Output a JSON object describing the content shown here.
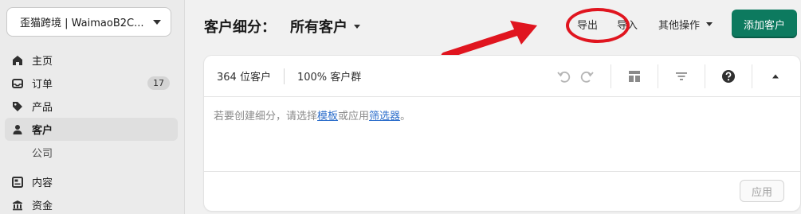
{
  "store": {
    "name": "歪猫跨境 | WaimaoB2C..."
  },
  "nav": {
    "home": "主页",
    "orders": "订单",
    "orders_badge": "17",
    "products": "产品",
    "customers": "客户",
    "company": "公司",
    "content": "内容",
    "finance": "资金"
  },
  "header": {
    "title_prefix": "客户细分：",
    "segment": "所有客户",
    "export": "导出",
    "import": "导入",
    "more_actions": "其他操作",
    "add_customer": "添加客户"
  },
  "card": {
    "customer_count": "364 位客户",
    "segment_share": "100% 客户群",
    "hint_prefix": "若要创建细分，请选择",
    "hint_template_link": "模板",
    "hint_middle": "或应用",
    "hint_filter_link": "筛选器",
    "hint_suffix": "。",
    "apply": "应用"
  },
  "colors": {
    "primary_button": "#0d7a5f",
    "annotation": "#e0151f",
    "link": "#2c6ecb"
  },
  "icons": [
    "house-icon",
    "inbox-icon",
    "tag-icon",
    "person-icon",
    "layout-icon",
    "bank-icon",
    "undo-icon",
    "redo-icon",
    "columns-icon",
    "filter-icon",
    "help-icon",
    "collapse-icon"
  ]
}
